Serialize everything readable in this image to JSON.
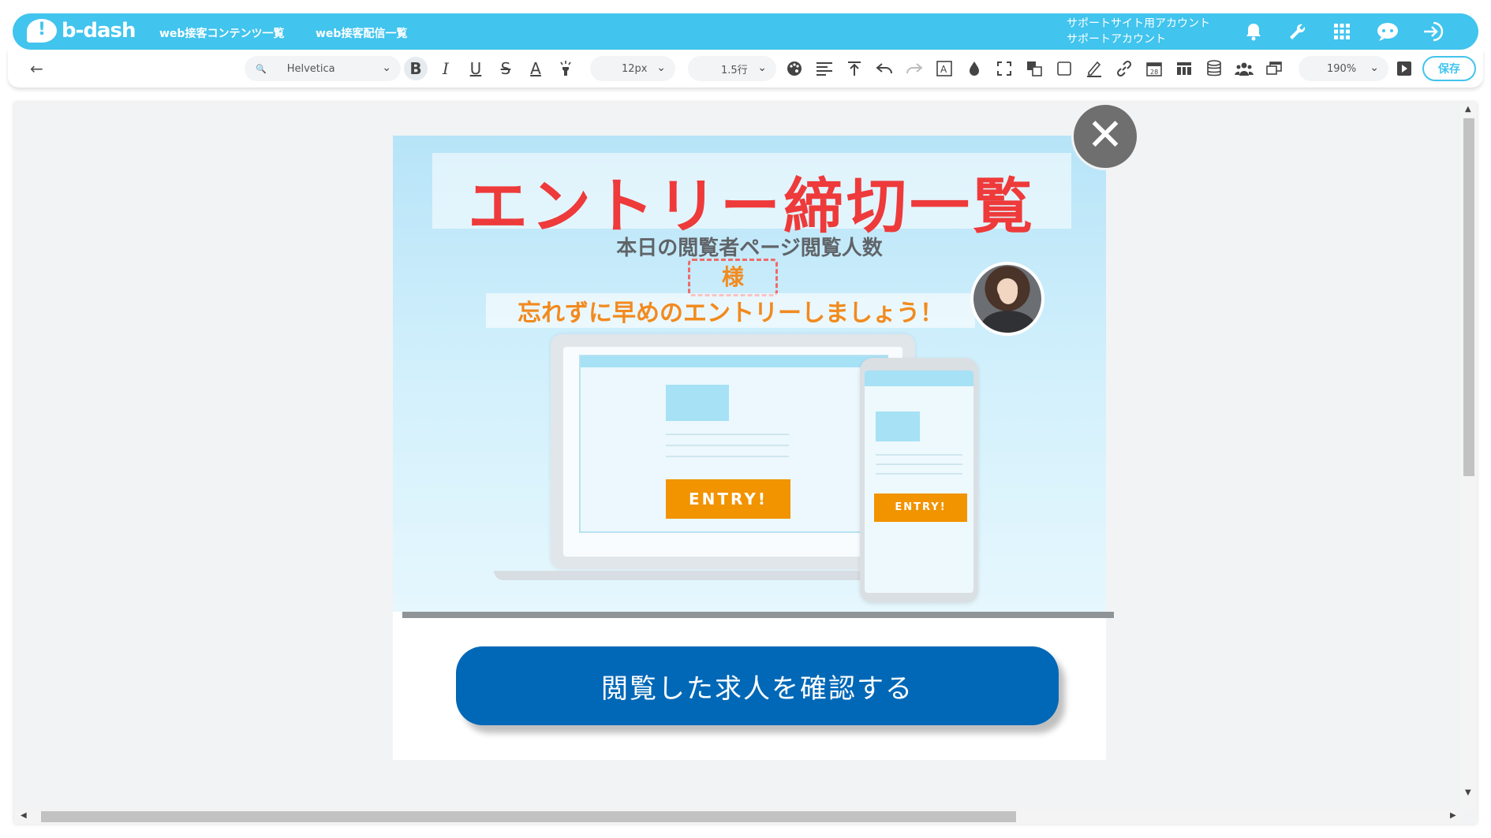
{
  "header": {
    "logo_text": "b-dash",
    "nav": [
      "web接客コンテンツ一覧",
      "web接客配信一覧"
    ],
    "account_line1": "サポートサイト用アカウント",
    "account_line2": "サポートアカウント",
    "accent_color": "#41c4ee"
  },
  "toolbar": {
    "font_family": "Helvetica",
    "font_size": "12px",
    "line_height": "1.5行",
    "zoom": "190%",
    "save_label": "保存"
  },
  "popup": {
    "headline": "エントリー締切一覧",
    "subtitle": "本日の閲覧者ページ閲覧人数",
    "name_placeholder": "様",
    "reminder": "忘れずに早めのエントリーしましょう！",
    "laptop_entry": "ENTRY!",
    "phone_entry": "ENTRY!",
    "confirm_label": "閲覧した求人を確認する",
    "confirm_color": "#0068b7"
  }
}
